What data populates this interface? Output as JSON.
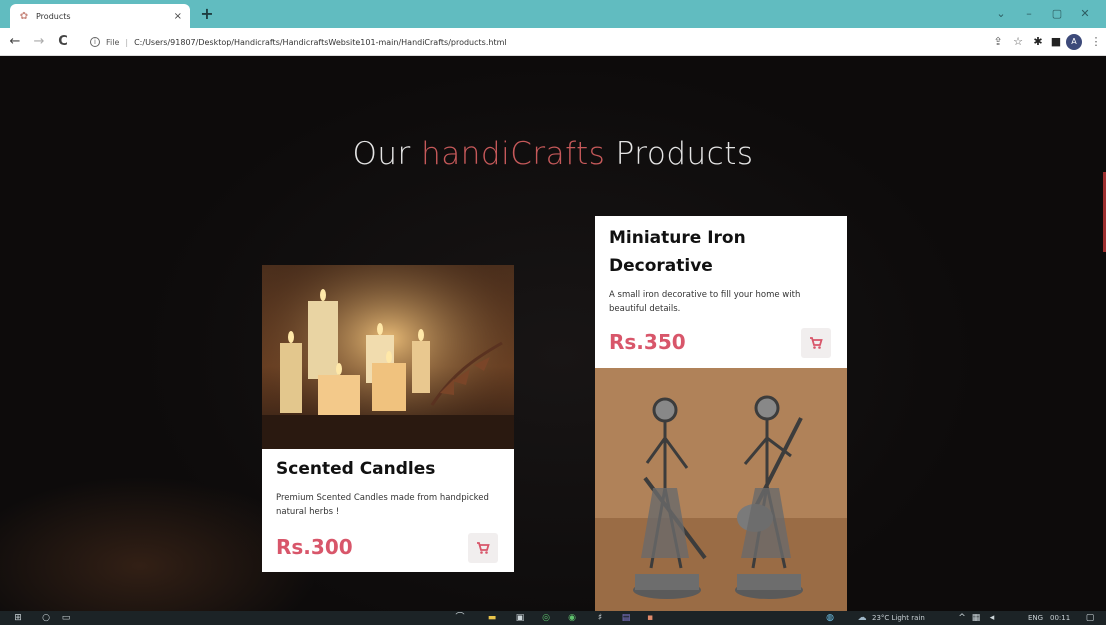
{
  "browser": {
    "tab_title": "Products",
    "tab_close": "×",
    "new_tab": "+",
    "url_scheme": "File",
    "url_sep": "|",
    "url": "C:/Users/91807/Desktop/Handicrafts/HandicraftsWebsite101-main/HandiCrafts/products.html",
    "avatar": "A",
    "theme_color": "#61bcc0"
  },
  "page": {
    "heading_before": "Our ",
    "heading_accent": "handiCrafts",
    "heading_after": " Products",
    "accent_color": "#c6595a",
    "price_color": "#d8566a"
  },
  "products": [
    {
      "title": "Scented Candles",
      "description": "Premium Scented Candles made from handpicked natural herbs !",
      "price": "Rs.300",
      "image": "candles-photo"
    },
    {
      "title": "Miniature Iron Decorative",
      "description": "A small iron decorative to fill your home with beautiful details.",
      "price": "Rs.350",
      "image": "iron-figurines-photo"
    }
  ],
  "taskbar": {
    "weather": "23°C  Light rain",
    "lang": "ENG",
    "time": "00:11"
  }
}
